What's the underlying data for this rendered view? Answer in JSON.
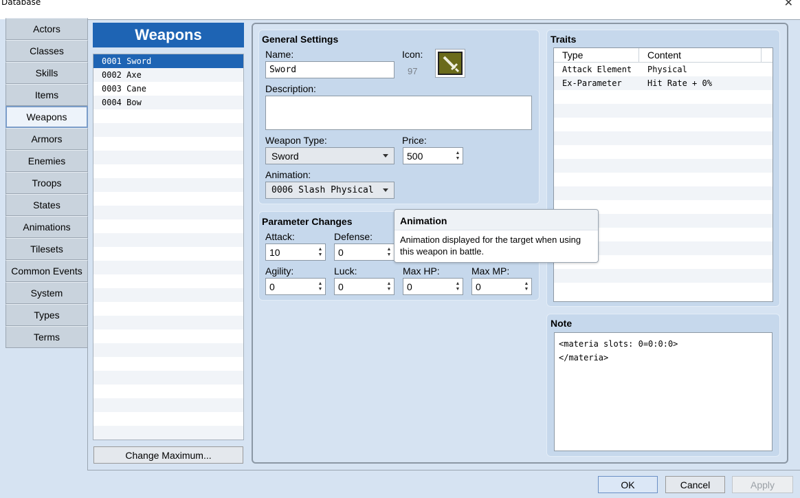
{
  "window": {
    "title": "Database",
    "close": "✕"
  },
  "tabs": [
    "Actors",
    "Classes",
    "Skills",
    "Items",
    "Weapons",
    "Armors",
    "Enemies",
    "Troops",
    "States",
    "Animations",
    "Tilesets",
    "Common Events",
    "System",
    "Types",
    "Terms"
  ],
  "active_tab": "Weapons",
  "list": {
    "header": "Weapons",
    "items": [
      "0001 Sword",
      "0002 Axe",
      "0003 Cane",
      "0004 Bow"
    ],
    "selected_index": 0,
    "change_max": "Change Maximum..."
  },
  "general": {
    "title": "General Settings",
    "name_label": "Name:",
    "name_value": "Sword",
    "icon_label": "Icon:",
    "icon_index": "97",
    "description_label": "Description:",
    "description_value": "",
    "weapon_type_label": "Weapon Type:",
    "weapon_type_value": "Sword",
    "price_label": "Price:",
    "price_value": "500",
    "animation_label": "Animation:",
    "animation_value": "0006 Slash Physical"
  },
  "params": {
    "title": "Parameter Changes",
    "attack_label": "Attack:",
    "attack_value": "10",
    "defense_label": "Defense:",
    "defense_value": "0",
    "agility_label": "Agility:",
    "agility_value": "0",
    "luck_label": "Luck:",
    "luck_value": "0",
    "maxhp_label": "Max HP:",
    "maxhp_value": "0",
    "maxmp_label": "Max MP:",
    "maxmp_value": "0"
  },
  "tooltip": {
    "title": "Animation",
    "body": "Animation displayed for the target when using this weapon in battle."
  },
  "traits": {
    "title": "Traits",
    "col_type": "Type",
    "col_content": "Content",
    "rows": [
      {
        "type": "Attack Element",
        "content": "Physical"
      },
      {
        "type": "Ex-Parameter",
        "content": "Hit Rate + 0%"
      }
    ]
  },
  "note": {
    "title": "Note",
    "value": "<materia slots: 0=0:0:0>\n</materia>"
  },
  "buttons": {
    "ok": "OK",
    "cancel": "Cancel",
    "apply": "Apply"
  },
  "colors": {
    "accent": "#1e64b4",
    "panel": "#c6d8ec",
    "background": "#d6e3f2",
    "icon_bg": "#6b6b1a"
  }
}
